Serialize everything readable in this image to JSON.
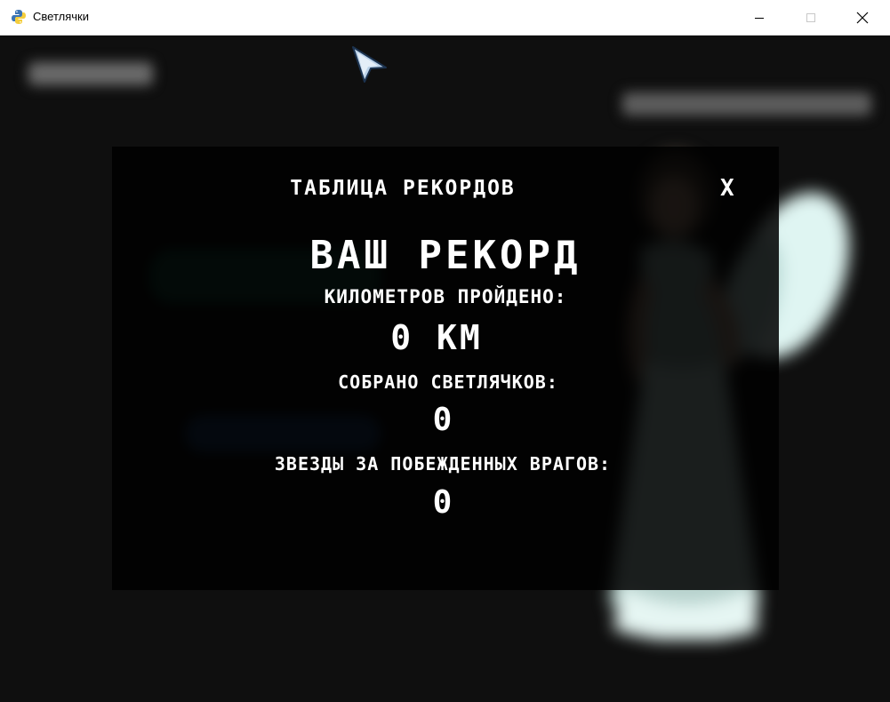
{
  "window": {
    "title": "Светлячки",
    "icons": {
      "app": "python-icon",
      "minimize": "minimize-icon",
      "maximize": "maximize-icon",
      "close": "close-icon"
    }
  },
  "records_panel": {
    "title": "ТАБЛИЦА РЕКОРДОВ",
    "close_label": "X",
    "record_heading": "ВАШ РЕКОРД",
    "km_label": "КИЛОМЕТРОВ ПРОЙДЕНО:",
    "km_value": "0 КМ",
    "fireflies_label": "СОБРАНО СВЕТЛЯЧКОВ:",
    "fireflies_value": "0",
    "stars_label": "ЗВЕЗДЫ ЗА ПОБЕЖДЕННЫХ ВРАГОВ:",
    "stars_value": "0"
  },
  "colors": {
    "panel_background": "#000000",
    "text": "#ffffff",
    "canvas_background": "#0f0f0f",
    "backdrop_green_button": "#16493a",
    "backdrop_blue_button": "#1d3c66"
  }
}
